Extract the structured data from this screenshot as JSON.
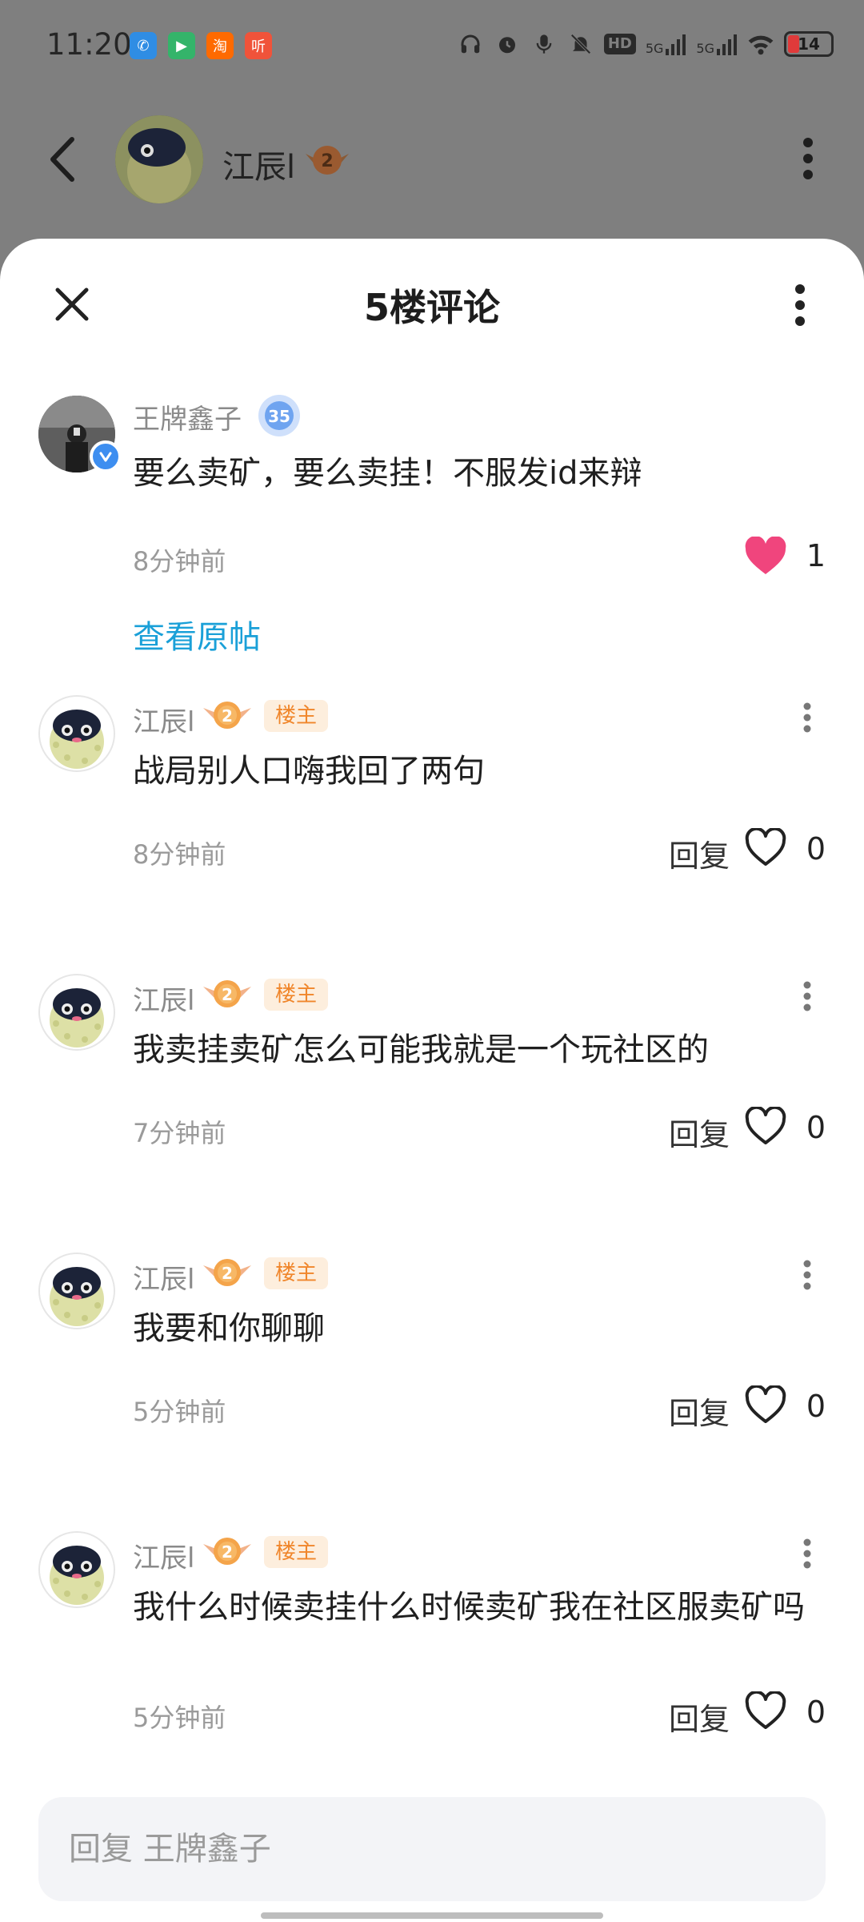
{
  "status_bar": {
    "time": "11:20",
    "apps": [
      {
        "icon": "phone-call-app-icon",
        "color": "#2f8de4",
        "glyph": "✆"
      },
      {
        "icon": "video-app-icon",
        "color": "#34b46a",
        "glyph": "▶"
      },
      {
        "icon": "taobao-app-icon",
        "color": "#ff6a00",
        "glyph": "淘"
      },
      {
        "icon": "audio-app-icon",
        "color": "#f0533a",
        "glyph": "听"
      }
    ],
    "network_labels": [
      "HD",
      "5G",
      "5G"
    ],
    "battery": "14"
  },
  "background_header": {
    "username": "江辰l",
    "level": "2"
  },
  "sheet": {
    "title": "5楼评论",
    "original_comment": {
      "username": "王牌鑫子",
      "level": "35",
      "text": "要么卖矿，要么卖挂！不服发id来辩",
      "time": "8分钟前",
      "likes": "1",
      "view_original_link": "查看原帖"
    },
    "replies": [
      {
        "username": "江辰l",
        "level": "2",
        "host_tag": "楼主",
        "text": "战局别人口嗨我回了两句",
        "time": "8分钟前",
        "reply_label": "回复",
        "likes": "0"
      },
      {
        "username": "江辰l",
        "level": "2",
        "host_tag": "楼主",
        "text": "我卖挂卖矿怎么可能我就是一个玩社区的",
        "time": "7分钟前",
        "reply_label": "回复",
        "likes": "0"
      },
      {
        "username": "江辰l",
        "level": "2",
        "host_tag": "楼主",
        "text": "我要和你聊聊",
        "time": "5分钟前",
        "reply_label": "回复",
        "likes": "0"
      },
      {
        "username": "江辰l",
        "level": "2",
        "host_tag": "楼主",
        "text": "我什么时候卖挂什么时候卖矿我在社区服卖矿吗",
        "time": "5分钟前",
        "reply_label": "回复",
        "likes": "0"
      }
    ],
    "reply_input": {
      "placeholder": "回复 王牌鑫子"
    }
  },
  "colors": {
    "link": "#1aa0d8",
    "like_active": "#f0457d",
    "host_tag_bg": "#fdeedd",
    "host_tag_text": "#f0862b",
    "level_badge": "#f4a44a"
  }
}
